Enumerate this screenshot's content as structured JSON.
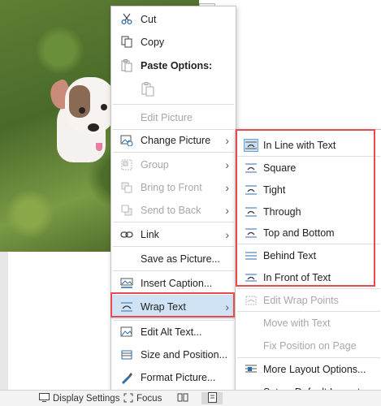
{
  "context_menu": {
    "items": [
      {
        "label": "Cut",
        "icon": "scissors-icon",
        "enabled": true
      },
      {
        "label": "Copy",
        "icon": "copy-icon",
        "enabled": true
      },
      {
        "label": "Paste Options:",
        "icon": "paste-icon",
        "enabled": true
      },
      {
        "label": "Edit Picture",
        "enabled": false
      },
      {
        "label": "Change Picture",
        "icon": "change-picture-icon",
        "enabled": true
      },
      {
        "label": "Group",
        "icon": "group-icon",
        "enabled": false
      },
      {
        "label": "Bring to Front",
        "icon": "bring-front-icon",
        "enabled": false
      },
      {
        "label": "Send to Back",
        "icon": "send-back-icon",
        "enabled": false
      },
      {
        "label": "Link",
        "icon": "link-icon",
        "enabled": true
      },
      {
        "label": "Save as Picture...",
        "enabled": true
      },
      {
        "label": "Insert Caption...",
        "icon": "caption-icon",
        "enabled": true
      },
      {
        "label": "Wrap Text",
        "icon": "wrap-text-icon",
        "enabled": true
      },
      {
        "label": "Edit Alt Text...",
        "icon": "alt-text-icon",
        "enabled": true
      },
      {
        "label": "Size and Position...",
        "icon": "size-position-icon",
        "enabled": true
      },
      {
        "label": "Format Picture...",
        "icon": "format-picture-icon",
        "enabled": true
      }
    ]
  },
  "wrap_submenu": {
    "items": [
      {
        "label": "In Line with Text",
        "icon": "inline-wrap-icon",
        "selected": true,
        "enabled": true
      },
      {
        "label": "Square",
        "icon": "square-wrap-icon",
        "enabled": true
      },
      {
        "label": "Tight",
        "icon": "tight-wrap-icon",
        "enabled": true
      },
      {
        "label": "Through",
        "icon": "through-wrap-icon",
        "enabled": true
      },
      {
        "label": "Top and Bottom",
        "icon": "top-bottom-wrap-icon",
        "enabled": true
      },
      {
        "label": "Behind Text",
        "icon": "behind-text-icon",
        "enabled": true
      },
      {
        "label": "In Front of Text",
        "icon": "front-text-icon",
        "enabled": true
      },
      {
        "label": "Edit Wrap Points",
        "icon": "edit-wrap-points-icon",
        "enabled": false
      },
      {
        "label": "Move with Text",
        "enabled": false
      },
      {
        "label": "Fix Position on Page",
        "enabled": false
      },
      {
        "label": "More Layout Options...",
        "icon": "layout-options-icon",
        "enabled": true
      },
      {
        "label": "Set as Default Layout",
        "enabled": true
      }
    ]
  },
  "status_bar": {
    "display_settings": "Display Settings",
    "focus": "Focus"
  },
  "colors": {
    "highlight_border": "#e84b4b",
    "hover": "#cfe3f5",
    "icon_blue": "#2b6cb0"
  }
}
